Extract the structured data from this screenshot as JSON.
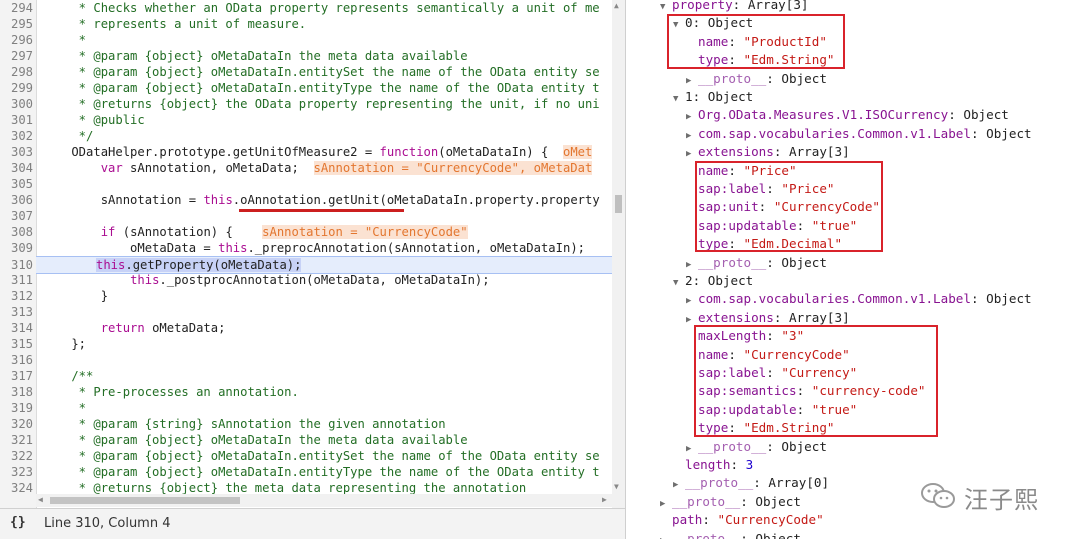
{
  "code_editor": {
    "lines": [
      {
        "n": "294",
        "segs": [
          {
            "c": "cm",
            "t": "     * Checks whether an OData property represents semantically a unit of me"
          }
        ]
      },
      {
        "n": "295",
        "segs": [
          {
            "c": "cm",
            "t": "     * represents a unit of measure."
          }
        ]
      },
      {
        "n": "296",
        "segs": [
          {
            "c": "cm",
            "t": "     *"
          }
        ]
      },
      {
        "n": "297",
        "segs": [
          {
            "c": "cm",
            "t": "     * @param {object} oMetaDataIn the meta data available"
          }
        ]
      },
      {
        "n": "298",
        "segs": [
          {
            "c": "cm",
            "t": "     * @param {object} oMetaDataIn.entitySet the name of the OData entity se"
          }
        ]
      },
      {
        "n": "299",
        "segs": [
          {
            "c": "cm",
            "t": "     * @param {object} oMetaDataIn.entityType the name of the OData entity t"
          }
        ]
      },
      {
        "n": "300",
        "segs": [
          {
            "c": "cm",
            "t": "     * @returns {object} the OData property representing the unit, if no uni"
          }
        ]
      },
      {
        "n": "301",
        "segs": [
          {
            "c": "cm",
            "t": "     * @public"
          }
        ]
      },
      {
        "n": "302",
        "segs": [
          {
            "c": "cm",
            "t": "     */"
          }
        ]
      },
      {
        "n": "303",
        "segs": [
          {
            "c": "tx",
            "t": "    ODataHelper.prototype.getUnitOfMeasure2 = "
          },
          {
            "c": "kw",
            "t": "function"
          },
          {
            "c": "tx",
            "t": "(oMetaDataIn) {  "
          },
          {
            "c": "inl",
            "t": "oMet"
          }
        ]
      },
      {
        "n": "304",
        "segs": [
          {
            "c": "tx",
            "t": "        "
          },
          {
            "c": "kw",
            "t": "var"
          },
          {
            "c": "tx",
            "t": " sAnnotation, oMetaData;  "
          },
          {
            "c": "inl",
            "t": "sAnnotation = \"CurrencyCode\", oMetaDat"
          }
        ]
      },
      {
        "n": "305",
        "segs": [
          {
            "c": "tx",
            "t": ""
          }
        ]
      },
      {
        "n": "306",
        "segs": [
          {
            "c": "tx",
            "t": "        sAnnotation = "
          },
          {
            "c": "kw",
            "t": "this"
          },
          {
            "c": "tx",
            "t": ".oAnnotation.getUnit(oMetaDataIn.property.property"
          }
        ]
      },
      {
        "n": "307",
        "segs": [
          {
            "c": "tx",
            "t": ""
          }
        ]
      },
      {
        "n": "308",
        "segs": [
          {
            "c": "tx",
            "t": "        "
          },
          {
            "c": "kw",
            "t": "if"
          },
          {
            "c": "tx",
            "t": " (sAnnotation) {    "
          },
          {
            "c": "inl",
            "t": "sAnnotation = \"CurrencyCode\""
          }
        ]
      },
      {
        "n": "309",
        "segs": [
          {
            "c": "tx",
            "t": "            oMetaData = "
          },
          {
            "c": "kw",
            "t": "this"
          },
          {
            "c": "tx",
            "t": "._preprocAnnotation(sAnnotation, oMetaDataIn);"
          }
        ]
      },
      {
        "n": "310",
        "segs": [
          {
            "c": "kw sel",
            "t": "this"
          },
          {
            "c": "tx sel",
            "t": ".getProperty(oMetaData);"
          }
        ],
        "current": true
      },
      {
        "n": "311",
        "segs": [
          {
            "c": "tx",
            "t": "            "
          },
          {
            "c": "kw",
            "t": "this"
          },
          {
            "c": "tx",
            "t": "._postprocAnnotation(oMetaData, oMetaDataIn);"
          }
        ]
      },
      {
        "n": "312",
        "segs": [
          {
            "c": "tx",
            "t": "        }"
          }
        ]
      },
      {
        "n": "313",
        "segs": [
          {
            "c": "tx",
            "t": ""
          }
        ]
      },
      {
        "n": "314",
        "segs": [
          {
            "c": "tx",
            "t": "        "
          },
          {
            "c": "kw",
            "t": "return"
          },
          {
            "c": "tx",
            "t": " oMetaData;"
          }
        ]
      },
      {
        "n": "315",
        "segs": [
          {
            "c": "tx",
            "t": "    };"
          }
        ]
      },
      {
        "n": "316",
        "segs": [
          {
            "c": "tx",
            "t": ""
          }
        ]
      },
      {
        "n": "317",
        "segs": [
          {
            "c": "cm",
            "t": "    /**"
          }
        ]
      },
      {
        "n": "318",
        "segs": [
          {
            "c": "cm",
            "t": "     * Pre-processes an annotation."
          }
        ]
      },
      {
        "n": "319",
        "segs": [
          {
            "c": "cm",
            "t": "     *"
          }
        ]
      },
      {
        "n": "320",
        "segs": [
          {
            "c": "cm",
            "t": "     * @param {string} sAnnotation the given annotation"
          }
        ]
      },
      {
        "n": "321",
        "segs": [
          {
            "c": "cm",
            "t": "     * @param {object} oMetaDataIn the meta data available"
          }
        ]
      },
      {
        "n": "322",
        "segs": [
          {
            "c": "cm",
            "t": "     * @param {object} oMetaDataIn.entitySet the name of the OData entity se"
          }
        ]
      },
      {
        "n": "323",
        "segs": [
          {
            "c": "cm",
            "t": "     * @param {object} oMetaDataIn.entityType the name of the OData entity t"
          }
        ]
      },
      {
        "n": "324",
        "segs": [
          {
            "c": "cm",
            "t": "     * @returns {object} the meta data representing the annotation"
          }
        ]
      }
    ]
  },
  "status_bar": {
    "braces": "{}",
    "position": "Line 310, Column 4"
  },
  "object_tree": {
    "rows": [
      {
        "indent": 0,
        "tri": "▼",
        "segs": [
          {
            "c": "pk",
            "t": "property"
          },
          {
            "c": "pv-obj",
            "t": ": Array[3]"
          }
        ]
      },
      {
        "indent": 1,
        "tri": "▼",
        "segs": [
          {
            "c": "pv-obj",
            "t": "0: Object"
          }
        ]
      },
      {
        "indent": 2,
        "tri": "",
        "segs": [
          {
            "c": "pk",
            "t": "name"
          },
          {
            "c": "pv-obj",
            "t": ": "
          },
          {
            "c": "pv-str",
            "t": "\"ProductId\""
          }
        ]
      },
      {
        "indent": 2,
        "tri": "",
        "segs": [
          {
            "c": "pk",
            "t": "type"
          },
          {
            "c": "pv-obj",
            "t": ": "
          },
          {
            "c": "pv-str",
            "t": "\"Edm.String\""
          }
        ]
      },
      {
        "indent": 2,
        "tri": "▶",
        "segs": [
          {
            "c": "pkd",
            "t": "__proto__"
          },
          {
            "c": "pv-obj",
            "t": ": Object"
          }
        ]
      },
      {
        "indent": 1,
        "tri": "▼",
        "segs": [
          {
            "c": "pv-obj",
            "t": "1: Object"
          }
        ]
      },
      {
        "indent": 2,
        "tri": "▶",
        "segs": [
          {
            "c": "pk",
            "t": "Org.OData.Measures.V1.ISOCurrency"
          },
          {
            "c": "pv-obj",
            "t": ": Object"
          }
        ]
      },
      {
        "indent": 2,
        "tri": "▶",
        "segs": [
          {
            "c": "pk",
            "t": "com.sap.vocabularies.Common.v1.Label"
          },
          {
            "c": "pv-obj",
            "t": ": Object"
          }
        ]
      },
      {
        "indent": 2,
        "tri": "▶",
        "segs": [
          {
            "c": "pk",
            "t": "extensions"
          },
          {
            "c": "pv-obj",
            "t": ": Array[3]"
          }
        ]
      },
      {
        "indent": 2,
        "tri": "",
        "segs": [
          {
            "c": "pk",
            "t": "name"
          },
          {
            "c": "pv-obj",
            "t": ": "
          },
          {
            "c": "pv-str",
            "t": "\"Price\""
          }
        ]
      },
      {
        "indent": 2,
        "tri": "",
        "segs": [
          {
            "c": "pk",
            "t": "sap:label"
          },
          {
            "c": "pv-obj",
            "t": ": "
          },
          {
            "c": "pv-str",
            "t": "\"Price\""
          }
        ]
      },
      {
        "indent": 2,
        "tri": "",
        "segs": [
          {
            "c": "pk",
            "t": "sap:unit"
          },
          {
            "c": "pv-obj",
            "t": ": "
          },
          {
            "c": "pv-str",
            "t": "\"CurrencyCode\""
          }
        ]
      },
      {
        "indent": 2,
        "tri": "",
        "segs": [
          {
            "c": "pk",
            "t": "sap:updatable"
          },
          {
            "c": "pv-obj",
            "t": ": "
          },
          {
            "c": "pv-str",
            "t": "\"true\""
          }
        ]
      },
      {
        "indent": 2,
        "tri": "",
        "segs": [
          {
            "c": "pk",
            "t": "type"
          },
          {
            "c": "pv-obj",
            "t": ": "
          },
          {
            "c": "pv-str",
            "t": "\"Edm.Decimal\""
          }
        ]
      },
      {
        "indent": 2,
        "tri": "▶",
        "segs": [
          {
            "c": "pkd",
            "t": "__proto__"
          },
          {
            "c": "pv-obj",
            "t": ": Object"
          }
        ]
      },
      {
        "indent": 1,
        "tri": "▼",
        "segs": [
          {
            "c": "pv-obj",
            "t": "2: Object"
          }
        ]
      },
      {
        "indent": 2,
        "tri": "▶",
        "segs": [
          {
            "c": "pk",
            "t": "com.sap.vocabularies.Common.v1.Label"
          },
          {
            "c": "pv-obj",
            "t": ": Object"
          }
        ]
      },
      {
        "indent": 2,
        "tri": "▶",
        "segs": [
          {
            "c": "pk",
            "t": "extensions"
          },
          {
            "c": "pv-obj",
            "t": ": Array[3]"
          }
        ]
      },
      {
        "indent": 2,
        "tri": "",
        "segs": [
          {
            "c": "pk",
            "t": "maxLength"
          },
          {
            "c": "pv-obj",
            "t": ": "
          },
          {
            "c": "pv-str",
            "t": "\"3\""
          }
        ]
      },
      {
        "indent": 2,
        "tri": "",
        "segs": [
          {
            "c": "pk",
            "t": "name"
          },
          {
            "c": "pv-obj",
            "t": ": "
          },
          {
            "c": "pv-str",
            "t": "\"CurrencyCode\""
          }
        ]
      },
      {
        "indent": 2,
        "tri": "",
        "segs": [
          {
            "c": "pk",
            "t": "sap:label"
          },
          {
            "c": "pv-obj",
            "t": ": "
          },
          {
            "c": "pv-str",
            "t": "\"Currency\""
          }
        ]
      },
      {
        "indent": 2,
        "tri": "",
        "segs": [
          {
            "c": "pk",
            "t": "sap:semantics"
          },
          {
            "c": "pv-obj",
            "t": ": "
          },
          {
            "c": "pv-str",
            "t": "\"currency-code\""
          }
        ]
      },
      {
        "indent": 2,
        "tri": "",
        "segs": [
          {
            "c": "pk",
            "t": "sap:updatable"
          },
          {
            "c": "pv-obj",
            "t": ": "
          },
          {
            "c": "pv-str",
            "t": "\"true\""
          }
        ]
      },
      {
        "indent": 2,
        "tri": "",
        "segs": [
          {
            "c": "pk",
            "t": "type"
          },
          {
            "c": "pv-obj",
            "t": ": "
          },
          {
            "c": "pv-str",
            "t": "\"Edm.String\""
          }
        ]
      },
      {
        "indent": 2,
        "tri": "▶",
        "segs": [
          {
            "c": "pkd",
            "t": "__proto__"
          },
          {
            "c": "pv-obj",
            "t": ": Object"
          }
        ]
      },
      {
        "indent": 1,
        "tri": "",
        "segs": [
          {
            "c": "pk",
            "t": "length"
          },
          {
            "c": "pv-obj",
            "t": ": "
          },
          {
            "c": "pv-num",
            "t": "3"
          }
        ]
      },
      {
        "indent": 1,
        "tri": "▶",
        "segs": [
          {
            "c": "pkd",
            "t": "__proto__"
          },
          {
            "c": "pv-obj",
            "t": ": Array[0]"
          }
        ]
      },
      {
        "indent": 0,
        "tri": "▶",
        "segs": [
          {
            "c": "pkd",
            "t": "__proto__"
          },
          {
            "c": "pv-obj",
            "t": ": Object"
          }
        ]
      },
      {
        "indent": 0,
        "tri": "",
        "segs": [
          {
            "c": "pk",
            "t": "path"
          },
          {
            "c": "pv-obj",
            "t": ": "
          },
          {
            "c": "pv-str",
            "t": "\"CurrencyCode\""
          }
        ]
      },
      {
        "indent": 0,
        "tri": "▶",
        "segs": [
          {
            "c": "pkd",
            "t": "__proto__"
          },
          {
            "c": "pv-obj",
            "t": ": Object"
          }
        ]
      }
    ]
  },
  "watermark": {
    "icon": "wechat-icon",
    "text": "汪子熙"
  },
  "colors": {
    "highlight_box": "#d9232b",
    "comment": "#236e25",
    "keyword": "#aa0d91",
    "string": "#c41a16"
  }
}
